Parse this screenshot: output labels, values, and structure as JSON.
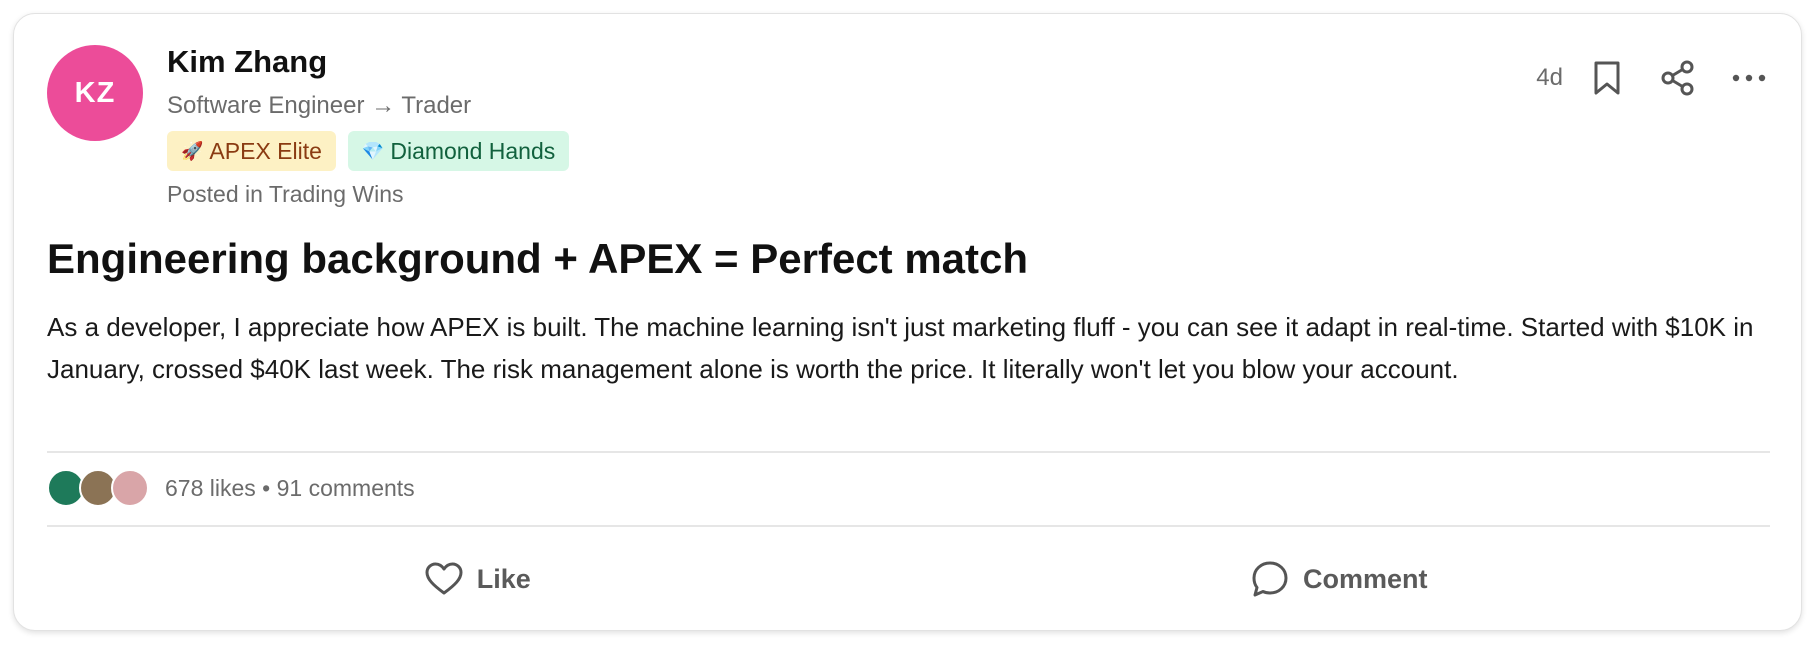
{
  "author": {
    "initials": "KZ",
    "name": "Kim Zhang",
    "role": "Software Engineer → Trader",
    "avatar_color": "#ec4c99"
  },
  "badges": [
    {
      "emoji": "🚀",
      "label": "APEX Elite",
      "bg": "#fdf1c4",
      "color": "#8a3b12"
    },
    {
      "emoji": "💎",
      "label": "Diamond Hands",
      "bg": "#d6f7e6",
      "color": "#11613d"
    }
  ],
  "posted_in": "Posted in Trading Wins",
  "header": {
    "time_ago": "4d",
    "icons": [
      "bookmark-icon",
      "share-icon",
      "more-options-icon"
    ]
  },
  "post": {
    "title": "Engineering background + APEX = Perfect match",
    "body": "As a developer, I appreciate how APEX is built. The machine learning isn't just marketing fluff - you can see it adapt in real-time. Started with $10K in January, crossed $40K last week. The risk management alone is worth the price. It literally won't let you blow your account."
  },
  "engagement": {
    "reactor_colors": [
      "#1e7a5a",
      "#8b7355",
      "#d9a5a8"
    ],
    "stats": "678 likes • 91 comments"
  },
  "actions": {
    "like_label": "Like",
    "comment_label": "Comment"
  }
}
